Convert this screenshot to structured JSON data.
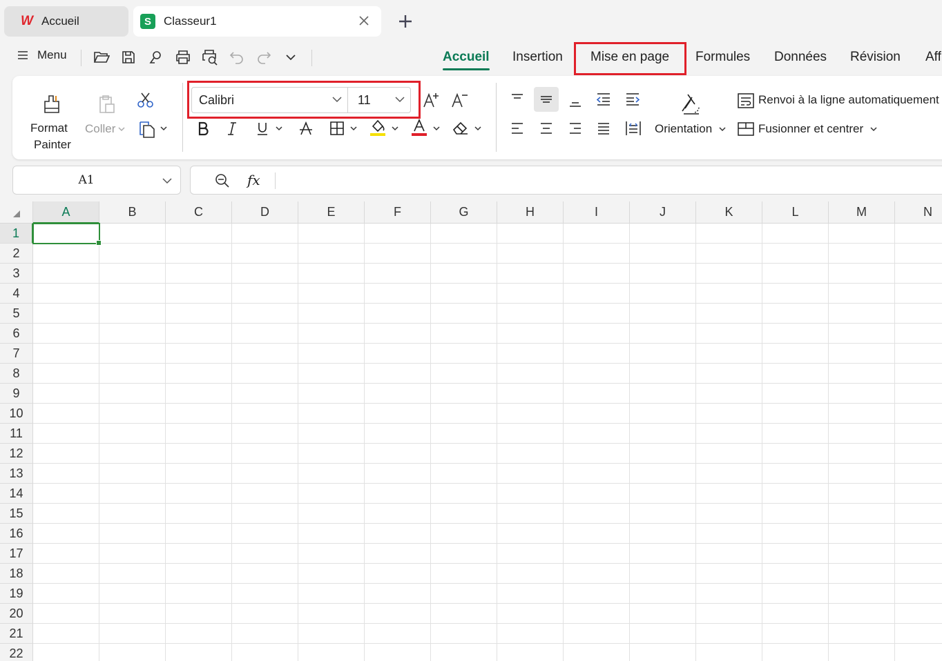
{
  "tabs": {
    "home_label": "Accueil",
    "doc_label": "Classeur1"
  },
  "toolbar": {
    "menu_label": "Menu"
  },
  "ribbon_tabs": [
    "Accueil",
    "Insertion",
    "Mise en page",
    "Formules",
    "Données",
    "Révision",
    "Aff"
  ],
  "ribbon": {
    "format_painter_line1": "Format",
    "format_painter_line2": "Painter",
    "paste_label": "Coller",
    "font_name": "Calibri",
    "font_size": "11",
    "orientation_label": "Orientation",
    "wrap_label": "Renvoi à la ligne automatiquement",
    "merge_label": "Fusionner et centrer"
  },
  "formula_bar": {
    "name_box": "A1",
    "fx_label": "fx",
    "value": ""
  },
  "sheet": {
    "columns": [
      "A",
      "B",
      "C",
      "D",
      "E",
      "F",
      "G",
      "H",
      "I",
      "J",
      "K",
      "L",
      "M",
      "N"
    ],
    "rows": [
      "1",
      "2",
      "3",
      "4",
      "5",
      "6",
      "7",
      "8",
      "9",
      "10",
      "11",
      "12",
      "13",
      "14",
      "15",
      "16",
      "17",
      "18",
      "19",
      "20",
      "21",
      "22"
    ],
    "selected_cell": "A1"
  },
  "colors": {
    "accent": "#0a7a55",
    "selection": "#2f8f3a",
    "highlight": "#e0202a",
    "wps_red": "#e0262d",
    "sheet_green": "#18a058"
  },
  "icons": [
    "wps-logo-icon",
    "sheet-logo-icon",
    "close-icon",
    "plus-icon",
    "hamburger-icon",
    "folder-open-icon",
    "save-icon",
    "export-icon",
    "print-icon",
    "print-preview-icon",
    "undo-icon",
    "redo-icon",
    "chevron-down-icon",
    "format-painter-icon",
    "paste-icon",
    "cut-icon",
    "copy-icon",
    "bold-icon",
    "italic-icon",
    "underline-icon",
    "strikethrough-icon",
    "borders-icon",
    "fill-color-icon",
    "font-color-icon",
    "clear-icon",
    "increase-font-icon",
    "decrease-font-icon",
    "align-top-icon",
    "align-middle-icon",
    "align-bottom-icon",
    "decrease-indent-icon",
    "increase-indent-icon",
    "align-left-icon",
    "align-center-icon",
    "align-right-icon",
    "justify-icon",
    "distributed-icon",
    "orientation-icon",
    "wrap-text-icon",
    "merge-center-icon",
    "zoom-icon"
  ]
}
